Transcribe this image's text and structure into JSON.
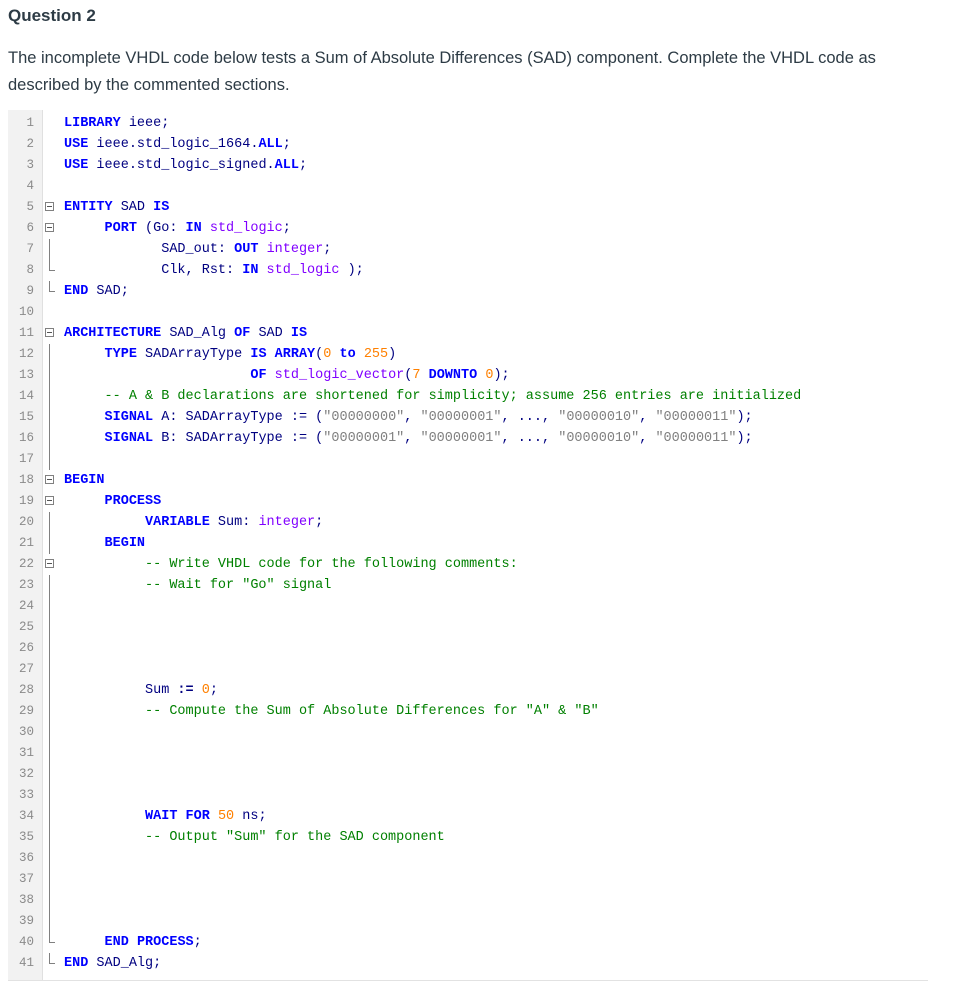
{
  "question": {
    "title": "Question 2",
    "text": "The incomplete VHDL code below tests a Sum of Absolute Differences (SAD) component. Complete the VHDL code as described by the commented sections."
  },
  "code": {
    "lines": [
      {
        "n": "1",
        "indent": "",
        "fold": "",
        "tokens": [
          [
            "kw",
            "LIBRARY"
          ],
          [
            "id",
            " ieee;"
          ]
        ]
      },
      {
        "n": "2",
        "indent": "",
        "fold": "",
        "tokens": [
          [
            "kw",
            "USE"
          ],
          [
            "id",
            " ieee.std_logic_1664."
          ],
          [
            "kw",
            "ALL"
          ],
          [
            "id",
            ";"
          ]
        ]
      },
      {
        "n": "3",
        "indent": "",
        "fold": "",
        "tokens": [
          [
            "kw",
            "USE"
          ],
          [
            "id",
            " ieee.std_logic_signed."
          ],
          [
            "kw",
            "ALL"
          ],
          [
            "id",
            ";"
          ]
        ]
      },
      {
        "n": "4",
        "indent": "",
        "fold": "",
        "tokens": []
      },
      {
        "n": "5",
        "indent": "",
        "fold": "open",
        "tokens": [
          [
            "kw",
            "ENTITY"
          ],
          [
            "id",
            " SAD "
          ],
          [
            "kw",
            "IS"
          ]
        ]
      },
      {
        "n": "6",
        "indent": "     ",
        "fold": "open",
        "tokens": [
          [
            "kw",
            "PORT"
          ],
          [
            "id",
            " (Go: "
          ],
          [
            "kw",
            "IN"
          ],
          [
            "id",
            " "
          ],
          [
            "ty",
            "std_logic"
          ],
          [
            "id",
            ";"
          ]
        ]
      },
      {
        "n": "7",
        "indent": "            ",
        "fold": "bar",
        "tokens": [
          [
            "id",
            "SAD_out: "
          ],
          [
            "kw",
            "OUT"
          ],
          [
            "id",
            " "
          ],
          [
            "ty",
            "integer"
          ],
          [
            "id",
            ";"
          ]
        ]
      },
      {
        "n": "8",
        "indent": "            ",
        "fold": "end",
        "tokens": [
          [
            "id",
            "Clk, Rst: "
          ],
          [
            "kw",
            "IN"
          ],
          [
            "id",
            " "
          ],
          [
            "ty",
            "std_logic"
          ],
          [
            "id",
            " );"
          ]
        ]
      },
      {
        "n": "9",
        "indent": "",
        "fold": "end",
        "tokens": [
          [
            "kw",
            "END"
          ],
          [
            "id",
            " SAD;"
          ]
        ]
      },
      {
        "n": "10",
        "indent": "",
        "fold": "",
        "tokens": []
      },
      {
        "n": "11",
        "indent": "",
        "fold": "open",
        "tokens": [
          [
            "kw",
            "ARCHITECTURE"
          ],
          [
            "id",
            " SAD_Alg "
          ],
          [
            "kw",
            "OF"
          ],
          [
            "id",
            " SAD "
          ],
          [
            "kw",
            "IS"
          ]
        ]
      },
      {
        "n": "12",
        "indent": "     ",
        "fold": "bar",
        "tokens": [
          [
            "kw",
            "TYPE"
          ],
          [
            "id",
            " SADArrayType "
          ],
          [
            "kw",
            "IS"
          ],
          [
            "id",
            " "
          ],
          [
            "kw",
            "ARRAY"
          ],
          [
            "id",
            "("
          ],
          [
            "num",
            "0"
          ],
          [
            "id",
            " "
          ],
          [
            "kw",
            "to"
          ],
          [
            "id",
            " "
          ],
          [
            "num",
            "255"
          ],
          [
            "id",
            ")"
          ]
        ]
      },
      {
        "n": "13",
        "indent": "                       ",
        "fold": "bar",
        "tokens": [
          [
            "kw",
            "OF"
          ],
          [
            "id",
            " "
          ],
          [
            "ty",
            "std_logic_vector"
          ],
          [
            "id",
            "("
          ],
          [
            "num",
            "7"
          ],
          [
            "id",
            " "
          ],
          [
            "kw",
            "DOWNTO"
          ],
          [
            "id",
            " "
          ],
          [
            "num",
            "0"
          ],
          [
            "id",
            ");"
          ]
        ]
      },
      {
        "n": "14",
        "indent": "     ",
        "fold": "bar",
        "tokens": [
          [
            "cm",
            "-- A & B declarations are shortened for simplicity; assume 256 entries are initialized"
          ]
        ]
      },
      {
        "n": "15",
        "indent": "     ",
        "fold": "bar",
        "tokens": [
          [
            "kw",
            "SIGNAL"
          ],
          [
            "id",
            " A: SADArrayType := ("
          ],
          [
            "str",
            "\"00000000\""
          ],
          [
            "id",
            ", "
          ],
          [
            "str",
            "\"00000001\""
          ],
          [
            "id",
            ", ..., "
          ],
          [
            "str",
            "\"00000010\""
          ],
          [
            "id",
            ", "
          ],
          [
            "str",
            "\"00000011\""
          ],
          [
            "id",
            ");"
          ]
        ]
      },
      {
        "n": "16",
        "indent": "     ",
        "fold": "bar",
        "tokens": [
          [
            "kw",
            "SIGNAL"
          ],
          [
            "id",
            " B: SADArrayType := ("
          ],
          [
            "str",
            "\"00000001\""
          ],
          [
            "id",
            ", "
          ],
          [
            "str",
            "\"00000001\""
          ],
          [
            "id",
            ", ..., "
          ],
          [
            "str",
            "\"00000010\""
          ],
          [
            "id",
            ", "
          ],
          [
            "str",
            "\"00000011\""
          ],
          [
            "id",
            ");"
          ]
        ]
      },
      {
        "n": "17",
        "indent": "",
        "fold": "bar",
        "tokens": []
      },
      {
        "n": "18",
        "indent": "",
        "fold": "open",
        "tokens": [
          [
            "kw",
            "BEGIN"
          ]
        ]
      },
      {
        "n": "19",
        "indent": "     ",
        "fold": "open",
        "tokens": [
          [
            "kw",
            "PROCESS"
          ]
        ]
      },
      {
        "n": "20",
        "indent": "          ",
        "fold": "bar",
        "tokens": [
          [
            "kw",
            "VARIABLE"
          ],
          [
            "id",
            " Sum: "
          ],
          [
            "ty",
            "integer"
          ],
          [
            "id",
            ";"
          ]
        ]
      },
      {
        "n": "21",
        "indent": "     ",
        "fold": "bar",
        "tokens": [
          [
            "kw",
            "BEGIN"
          ]
        ]
      },
      {
        "n": "22",
        "indent": "          ",
        "fold": "open",
        "tokens": [
          [
            "cm",
            "-- Write VHDL code for the following comments:"
          ]
        ]
      },
      {
        "n": "23",
        "indent": "          ",
        "fold": "bar",
        "tokens": [
          [
            "cm",
            "-- Wait for \"Go\" signal"
          ]
        ]
      },
      {
        "n": "24",
        "indent": "",
        "fold": "bar",
        "tokens": []
      },
      {
        "n": "25",
        "indent": "",
        "fold": "bar",
        "tokens": []
      },
      {
        "n": "26",
        "indent": "",
        "fold": "bar",
        "tokens": []
      },
      {
        "n": "27",
        "indent": "",
        "fold": "bar",
        "tokens": []
      },
      {
        "n": "28",
        "indent": "          ",
        "fold": "bar",
        "tokens": [
          [
            "id",
            "Sum "
          ],
          [
            "op",
            ":="
          ],
          [
            "id",
            " "
          ],
          [
            "num",
            "0"
          ],
          [
            "id",
            ";"
          ]
        ]
      },
      {
        "n": "29",
        "indent": "          ",
        "fold": "bar",
        "tokens": [
          [
            "cm",
            "-- Compute the Sum of Absolute Differences for \"A\" & \"B\""
          ]
        ]
      },
      {
        "n": "30",
        "indent": "",
        "fold": "bar",
        "tokens": []
      },
      {
        "n": "31",
        "indent": "",
        "fold": "bar",
        "tokens": []
      },
      {
        "n": "32",
        "indent": "",
        "fold": "bar",
        "tokens": []
      },
      {
        "n": "33",
        "indent": "",
        "fold": "bar",
        "tokens": []
      },
      {
        "n": "34",
        "indent": "          ",
        "fold": "bar",
        "tokens": [
          [
            "kw",
            "WAIT"
          ],
          [
            "id",
            " "
          ],
          [
            "kw",
            "FOR"
          ],
          [
            "id",
            " "
          ],
          [
            "num",
            "50"
          ],
          [
            "id",
            " ns;"
          ]
        ]
      },
      {
        "n": "35",
        "indent": "          ",
        "fold": "bar",
        "tokens": [
          [
            "cm",
            "-- Output \"Sum\" for the SAD component"
          ]
        ]
      },
      {
        "n": "36",
        "indent": "",
        "fold": "bar",
        "tokens": []
      },
      {
        "n": "37",
        "indent": "",
        "fold": "bar",
        "tokens": []
      },
      {
        "n": "38",
        "indent": "",
        "fold": "bar",
        "tokens": []
      },
      {
        "n": "39",
        "indent": "",
        "fold": "bar",
        "tokens": []
      },
      {
        "n": "40",
        "indent": "     ",
        "fold": "end",
        "tokens": [
          [
            "kw",
            "END"
          ],
          [
            "id",
            " "
          ],
          [
            "kw",
            "PROCESS"
          ],
          [
            "id",
            ";"
          ]
        ]
      },
      {
        "n": "41",
        "indent": "",
        "fold": "end",
        "tokens": [
          [
            "kw",
            "END"
          ],
          [
            "id",
            " SAD_Alg;"
          ]
        ]
      }
    ]
  }
}
